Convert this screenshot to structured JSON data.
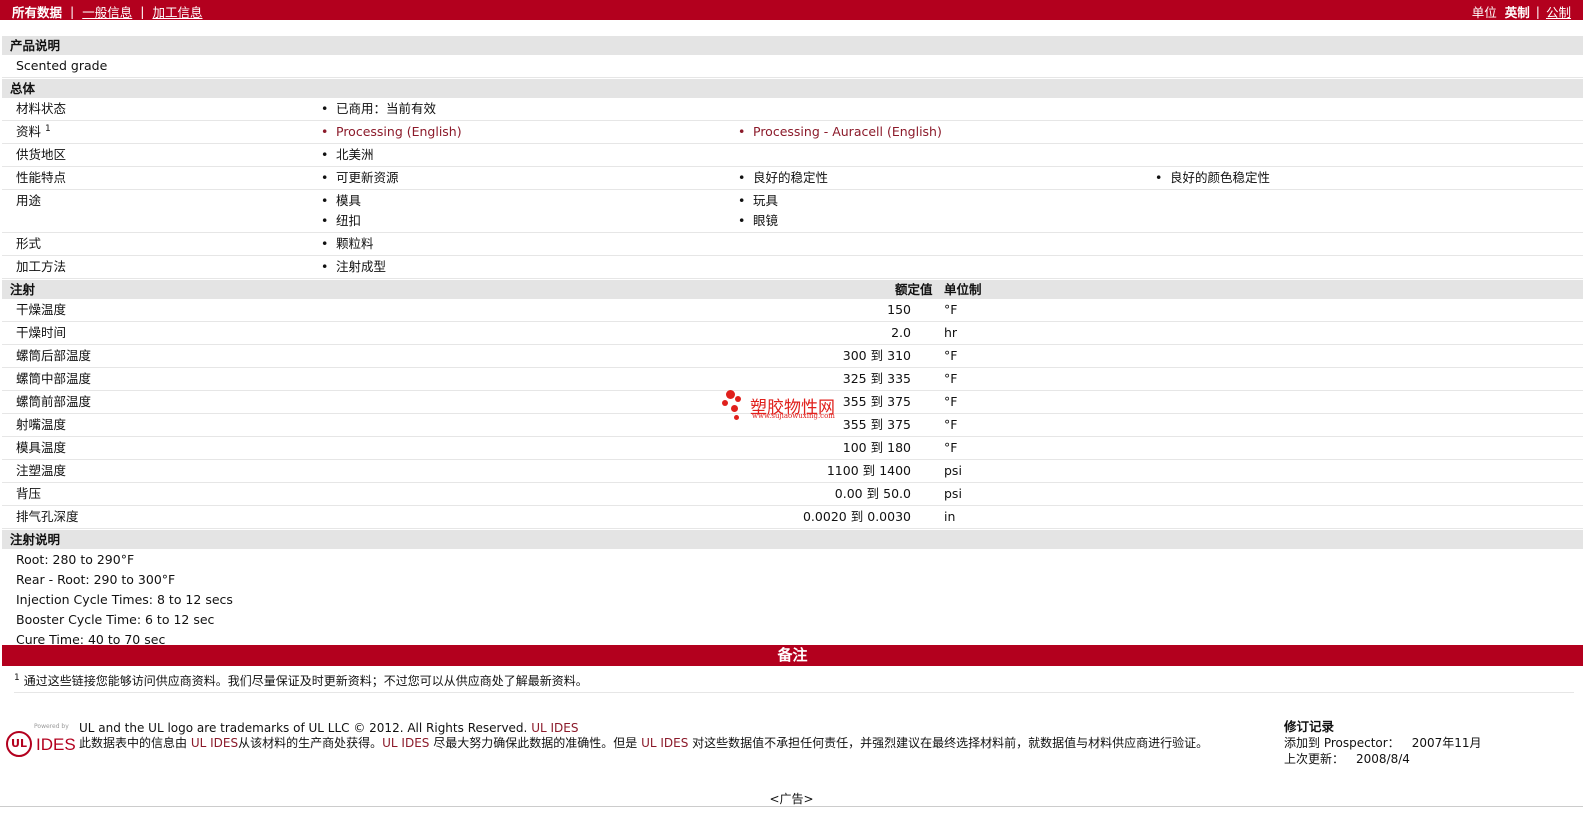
{
  "topbar": {
    "tab_all": "所有数据",
    "tab_general": "一般信息",
    "tab_processing": "加工信息",
    "units_label": "单位",
    "units_english": "英制",
    "units_metric": "公制"
  },
  "product_desc": {
    "header": "产品说明",
    "text": "Scented grade"
  },
  "general": {
    "header": "总体",
    "rows": [
      {
        "label": "材料状态",
        "values": [
          "已商用：当前有效"
        ]
      },
      {
        "label": "资料",
        "sup": "1",
        "values": [
          "Processing (English)",
          "Processing - Auracell (English)"
        ]
      },
      {
        "label": "供货地区",
        "values": [
          "北美洲"
        ]
      },
      {
        "label": "性能特点",
        "values": [
          "可更新资源",
          "良好的稳定性",
          "良好的颜色稳定性"
        ]
      },
      {
        "label": "用途",
        "values": [
          "模具",
          "玩具",
          "纽扣",
          "眼镜"
        ]
      },
      {
        "label": "形式",
        "values": [
          "颗粒料"
        ]
      },
      {
        "label": "加工方法",
        "values": [
          "注射成型"
        ]
      }
    ]
  },
  "injection": {
    "header": "注射",
    "col_nominal": "额定值",
    "col_unit": "单位制",
    "to_word": "到",
    "rows": [
      {
        "label": "干燥温度",
        "low": "",
        "high": "150",
        "unit": "°F"
      },
      {
        "label": "干燥时间",
        "low": "",
        "high": "2.0",
        "unit": "hr"
      },
      {
        "label": "螺筒后部温度",
        "low": "300",
        "high": "310",
        "unit": "°F"
      },
      {
        "label": "螺筒中部温度",
        "low": "325",
        "high": "335",
        "unit": "°F"
      },
      {
        "label": "螺筒前部温度",
        "low": "355",
        "high": "375",
        "unit": "°F"
      },
      {
        "label": "射嘴温度",
        "low": "355",
        "high": "375",
        "unit": "°F"
      },
      {
        "label": "模具温度",
        "low": "100",
        "high": "180",
        "unit": "°F"
      },
      {
        "label": "注塑温度",
        "low": "1100",
        "high": "1400",
        "unit": "psi"
      },
      {
        "label": "背压",
        "low": "0.00",
        "high": "50.0",
        "unit": "psi"
      },
      {
        "label": "排气孔深度",
        "low": "0.0020",
        "high": "0.0030",
        "unit": "in"
      }
    ]
  },
  "injection_notes": {
    "header": "注射说明",
    "lines": [
      "Root: 280 to 290°F",
      "Rear - Root: 290 to 300°F",
      "Injection Cycle Times: 8 to 12 secs",
      "Booster Cycle Time: 6 to 12 sec",
      "Cure Time: 40 to 70 sec"
    ]
  },
  "remarks": {
    "header": "备注",
    "sup": "1",
    "text": "通过这些链接您能够访问供应商资料。我们尽量保证及时更新资料；不过您可以从供应商处了解最新资料。"
  },
  "footer": {
    "logo_small": "Powered by",
    "logo_ul": "UL",
    "logo_ides": "IDES",
    "trademark_text": "UL and the UL logo are trademarks of UL LLC © 2012. All Rights Reserved.",
    "trademark_accent": "UL IDES",
    "disclaimer_1": "此数据表中的信息由",
    "disclaimer_accent_1": "UL IDES",
    "disclaimer_2": "从该材料的生产商处获得。",
    "disclaimer_accent_2": "UL IDES",
    "disclaimer_3": "尽最大努力确保此数据的准确性。但是",
    "disclaimer_accent_3": "UL IDES",
    "disclaimer_4": "对这些数据值不承担任何责任，并强烈建议在最终选择材料前，就数据值与材料供应商进行验证。",
    "revision_title": "修订记录",
    "added_label": "添加到 Prospector：",
    "added_value": "2007年11月",
    "updated_label": "上次更新：",
    "updated_value": "2008/8/4",
    "ad": "<广告>"
  },
  "watermark": {
    "text": "塑胶物性网",
    "url": "www.sujiaowuxing.com",
    "color": "#e0201c"
  },
  "colors": {
    "brand": "#b3001e",
    "link": "#8b1a2a",
    "section_bg": "#e4e4e4"
  }
}
